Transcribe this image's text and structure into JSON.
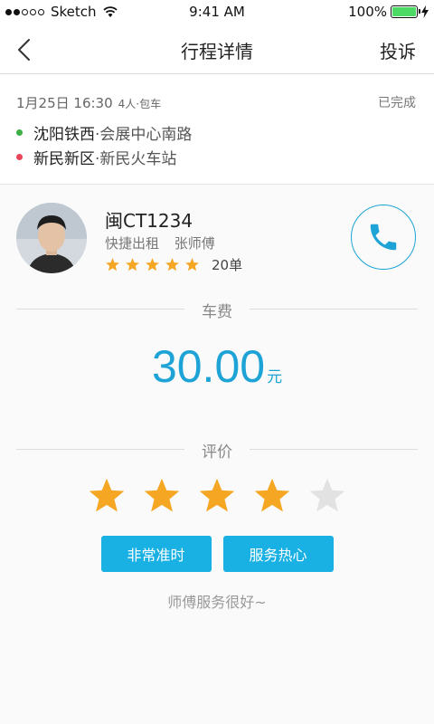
{
  "status_bar": {
    "carrier": "Sketch",
    "time": "9:41 AM",
    "battery": "100%"
  },
  "nav": {
    "title": "行程详情",
    "action": "投诉"
  },
  "trip": {
    "datetime": "1月25日 16:30",
    "passengers": "4人·包车",
    "status": "已完成",
    "from_city": "沈阳铁西",
    "from_detail": "·会展中心南路",
    "to_city": "新民新区",
    "to_detail": "·新民火车站"
  },
  "driver": {
    "plate": "闽CT1234",
    "company": "快捷出租",
    "name": "张师傅",
    "rating_stars": 5,
    "orders": "20单"
  },
  "fare": {
    "section_label": "车费",
    "amount": "30.00",
    "unit": "元"
  },
  "review": {
    "section_label": "评价",
    "stars": 4,
    "max_stars": 5,
    "tags": [
      "非常准时",
      "服务热心"
    ],
    "comment": "师傅服务很好~"
  },
  "colors": {
    "accent": "#1ea3d6",
    "tag_bg": "#19b0e3",
    "star": "#f5a623",
    "star_empty": "#e2e2e2",
    "from_dot": "#3cb043",
    "to_dot": "#e8445b"
  }
}
